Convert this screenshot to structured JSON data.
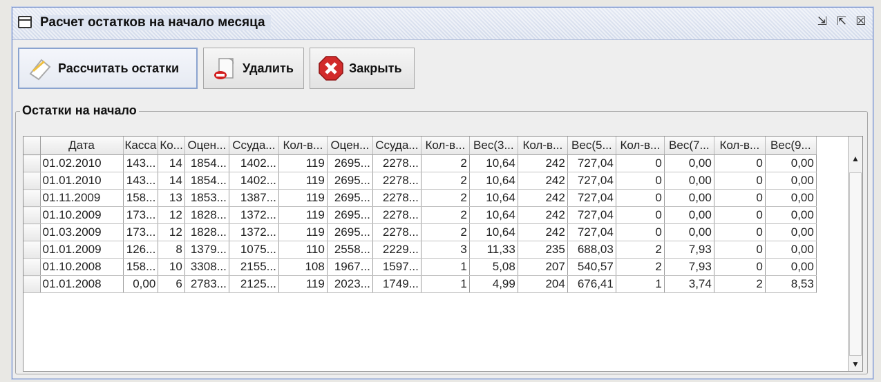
{
  "window": {
    "title": "Расчет остатков на начало месяца",
    "buttons": {
      "minimize": "⇲",
      "maximize": "⇱",
      "close": "☒"
    }
  },
  "toolbar": {
    "calculate_label": "Рассчитать остатки",
    "delete_label": "Удалить",
    "close_label": "Закрыть"
  },
  "group": {
    "title": "Остатки на начало"
  },
  "table": {
    "headers": [
      "Дата",
      "Касса",
      "Ко...",
      "Оцен...",
      "Ссуда...",
      "Кол-в...",
      "Оцен...",
      "Ссуда...",
      "Кол-в...",
      "Вес(3...",
      "Кол-в...",
      "Вес(5...",
      "Кол-в...",
      "Вес(7...",
      "Кол-в...",
      "Вес(9..."
    ],
    "rows": [
      [
        "01.02.2010",
        "143...",
        "14",
        "1854...",
        "1402...",
        "119",
        "2695...",
        "2278...",
        "2",
        "10,64",
        "242",
        "727,04",
        "0",
        "0,00",
        "0",
        "0,00"
      ],
      [
        "01.01.2010",
        "143...",
        "14",
        "1854...",
        "1402...",
        "119",
        "2695...",
        "2278...",
        "2",
        "10,64",
        "242",
        "727,04",
        "0",
        "0,00",
        "0",
        "0,00"
      ],
      [
        "01.11.2009",
        "158...",
        "13",
        "1853...",
        "1387...",
        "119",
        "2695...",
        "2278...",
        "2",
        "10,64",
        "242",
        "727,04",
        "0",
        "0,00",
        "0",
        "0,00"
      ],
      [
        "01.10.2009",
        "173...",
        "12",
        "1828...",
        "1372...",
        "119",
        "2695...",
        "2278...",
        "2",
        "10,64",
        "242",
        "727,04",
        "0",
        "0,00",
        "0",
        "0,00"
      ],
      [
        "01.03.2009",
        "173...",
        "12",
        "1828...",
        "1372...",
        "119",
        "2695...",
        "2278...",
        "2",
        "10,64",
        "242",
        "727,04",
        "0",
        "0,00",
        "0",
        "0,00"
      ],
      [
        "01.01.2009",
        "126...",
        "8",
        "1379...",
        "1075...",
        "110",
        "2558...",
        "2229...",
        "3",
        "11,33",
        "235",
        "688,03",
        "2",
        "7,93",
        "0",
        "0,00"
      ],
      [
        "01.10.2008",
        "158...",
        "10",
        "3308...",
        "2155...",
        "108",
        "1967...",
        "1597...",
        "1",
        "5,08",
        "207",
        "540,57",
        "2",
        "7,93",
        "0",
        "0,00"
      ],
      [
        "01.01.2008",
        "0,00",
        "6",
        "2783...",
        "2125...",
        "119",
        "2023...",
        "1749...",
        "1",
        "4,99",
        "204",
        "676,41",
        "1",
        "3,74",
        "2",
        "8,53"
      ]
    ]
  },
  "scrollbar": {
    "up": "▲",
    "down": "▼"
  }
}
